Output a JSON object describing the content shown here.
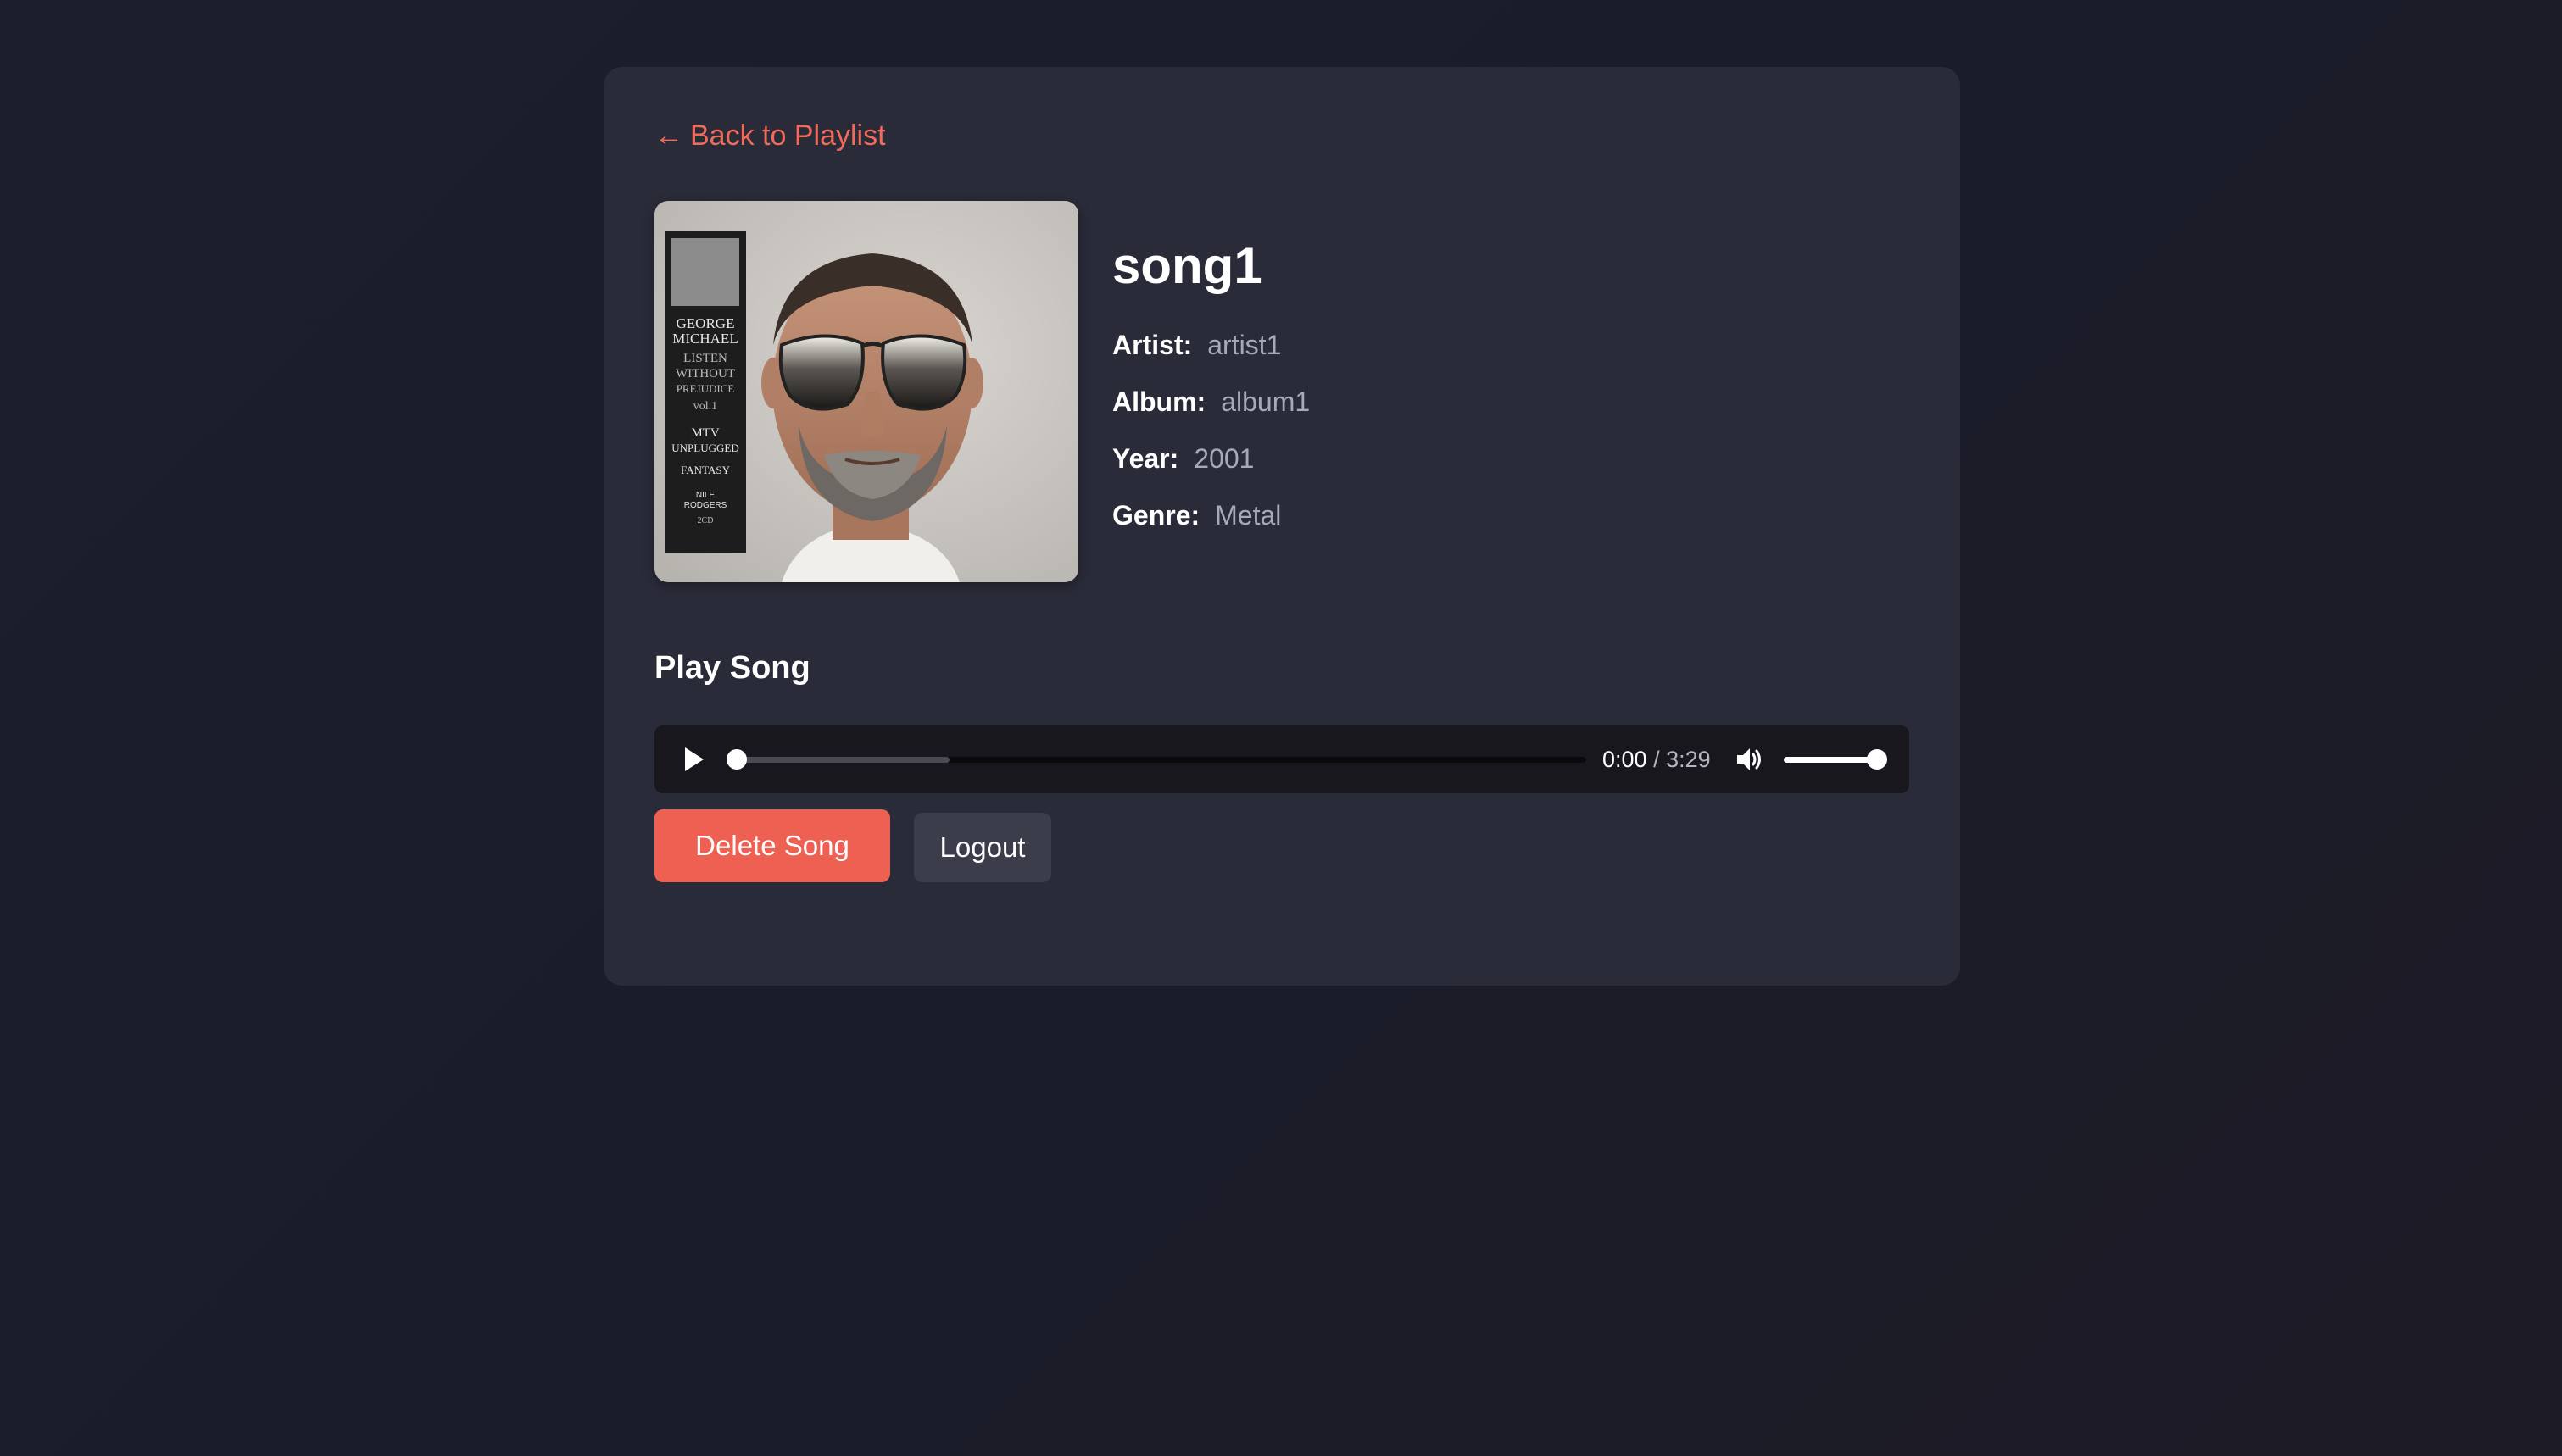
{
  "nav": {
    "back_arrow": "←",
    "back_label": "Back to Playlist"
  },
  "song": {
    "title": "song1",
    "cover_alt": "Album cover",
    "cover_spine_text": [
      "GEORGE",
      "MICHAEL",
      "LISTEN",
      "WITHOUT",
      "PREJUDICE",
      "vol.1",
      "MTV",
      "UNPLUGGED",
      "FANTASY",
      "NILE",
      "RODGERS",
      "2CD"
    ],
    "meta": [
      {
        "label": "Artist:",
        "value": "artist1"
      },
      {
        "label": "Album:",
        "value": "album1"
      },
      {
        "label": "Year:",
        "value": "2001"
      },
      {
        "label": "Genre:",
        "value": "Metal"
      }
    ]
  },
  "player_section": {
    "title": "Play Song"
  },
  "player": {
    "play_icon": "play-icon",
    "current_time": "0:00",
    "separator": "/",
    "duration": "3:29",
    "progress_fraction": 0.0,
    "buffered_fraction": 0.25,
    "volume_icon": "volume-icon",
    "volume_fraction": 1.0
  },
  "actions": {
    "delete_label": "Delete Song",
    "logout_label": "Logout"
  },
  "colors": {
    "accent": "#ee6152",
    "link": "#f06b5c",
    "card": "#2a2b39",
    "background": "#1c1e2c",
    "secondary_button": "#3c3d4b",
    "player_bg": "#17171d"
  }
}
